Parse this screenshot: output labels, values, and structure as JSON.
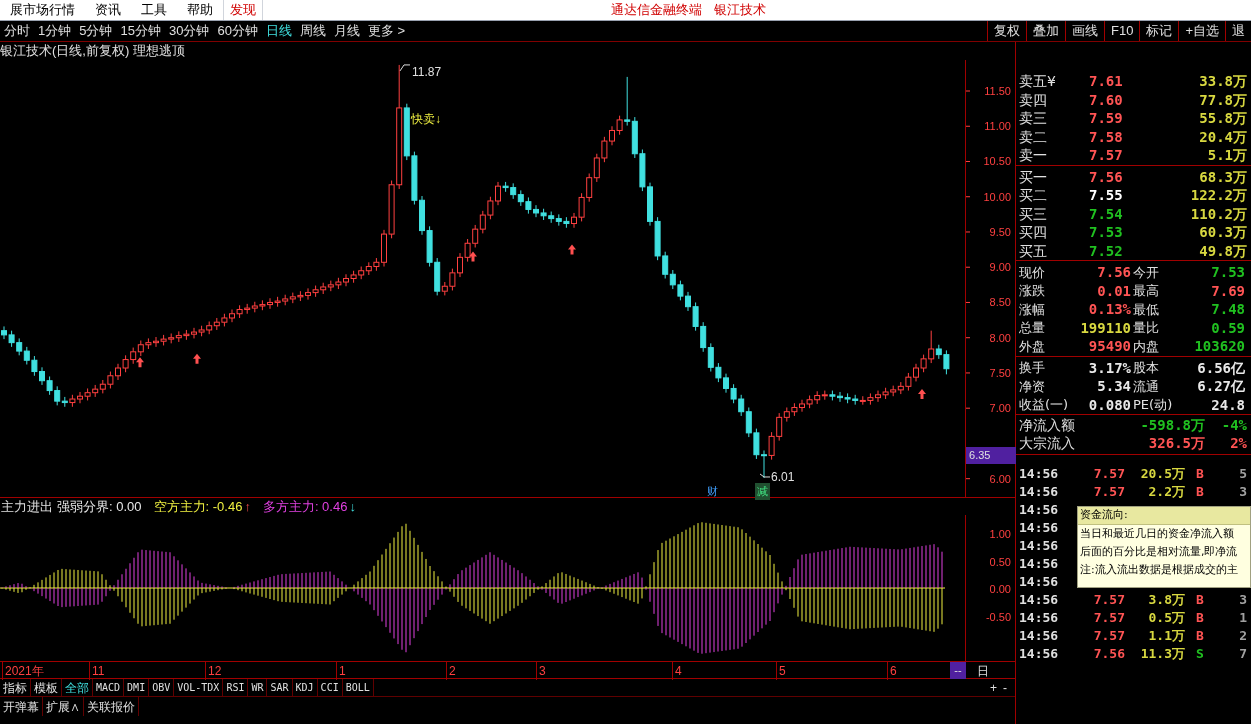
{
  "menu_bar": {
    "items": [
      "展市场行情",
      "资讯",
      "工具",
      "帮助"
    ],
    "discover": "发现",
    "app_title": "通达信金融终端",
    "stock_name": "银江技术"
  },
  "period_bar": {
    "periods": [
      {
        "label": "分时",
        "selected": false
      },
      {
        "label": "1分钟",
        "selected": false
      },
      {
        "label": "5分钟",
        "selected": false
      },
      {
        "label": "15分钟",
        "selected": false
      },
      {
        "label": "30分钟",
        "selected": false
      },
      {
        "label": "60分钟",
        "selected": false
      },
      {
        "label": "日线",
        "selected": true
      },
      {
        "label": "周线",
        "selected": false
      },
      {
        "label": "月线",
        "selected": false
      },
      {
        "label": "更多 >",
        "selected": false
      }
    ],
    "tools": [
      "复权",
      "叠加",
      "画线",
      "F10",
      "标记",
      "+自选",
      "退"
    ]
  },
  "chart_title": "银江技术(日线,前复权) 理想逃顶",
  "price_chart": {
    "chart_data": {
      "type": "candlestick",
      "ylim": [
        5.74,
        11.94
      ],
      "yticks": [
        {
          "value": 11.5,
          "label": "11.50"
        },
        {
          "value": 11,
          "label": "11.00"
        },
        {
          "value": 10.5,
          "label": "10.50"
        },
        {
          "value": 10,
          "label": "10.00"
        },
        {
          "value": 9.5,
          "label": "9.50"
        },
        {
          "value": 9,
          "label": "9.00"
        },
        {
          "value": 8.5,
          "label": "8.50"
        },
        {
          "value": 8,
          "label": "8.00"
        },
        {
          "value": 7.5,
          "label": "7.50"
        },
        {
          "value": 7,
          "label": "7.00"
        },
        {
          "value": 6,
          "label": "6.00"
        }
      ],
      "ohlc": [
        [
          8.1,
          8.16,
          7.98,
          8.04
        ],
        [
          8.04,
          8.1,
          7.87,
          7.93
        ],
        [
          7.93,
          7.99,
          7.75,
          7.81
        ],
        [
          7.81,
          7.87,
          7.62,
          7.68
        ],
        [
          7.68,
          7.74,
          7.46,
          7.52
        ],
        [
          7.52,
          7.58,
          7.33,
          7.39
        ],
        [
          7.39,
          7.45,
          7.19,
          7.25
        ],
        [
          7.25,
          7.31,
          7.04,
          7.1
        ],
        [
          7.1,
          7.16,
          7.02,
          7.08
        ],
        [
          7.08,
          7.19,
          7.02,
          7.13
        ],
        [
          7.13,
          7.23,
          7.07,
          7.17
        ],
        [
          7.17,
          7.28,
          7.11,
          7.22
        ],
        [
          7.22,
          7.33,
          7.16,
          7.27
        ],
        [
          7.27,
          7.4,
          7.21,
          7.34
        ],
        [
          7.34,
          7.52,
          7.28,
          7.46
        ],
        [
          7.46,
          7.63,
          7.4,
          7.57
        ],
        [
          7.57,
          7.75,
          7.51,
          7.69
        ],
        [
          7.69,
          7.86,
          7.63,
          7.8
        ],
        [
          7.8,
          7.96,
          7.74,
          7.9
        ],
        [
          7.9,
          7.99,
          7.84,
          7.93
        ],
        [
          7.93,
          8.01,
          7.87,
          7.95
        ],
        [
          7.95,
          8.04,
          7.89,
          7.98
        ],
        [
          7.98,
          8.06,
          7.92,
          8.0
        ],
        [
          8.0,
          8.09,
          7.94,
          8.03
        ],
        [
          8.03,
          8.11,
          7.97,
          8.05
        ],
        [
          8.05,
          8.14,
          7.99,
          8.08
        ],
        [
          8.08,
          8.17,
          8.02,
          8.11
        ],
        [
          8.11,
          8.23,
          8.05,
          8.17
        ],
        [
          8.17,
          8.28,
          8.11,
          8.22
        ],
        [
          8.22,
          8.34,
          8.16,
          8.28
        ],
        [
          8.28,
          8.4,
          8.22,
          8.34
        ],
        [
          8.34,
          8.46,
          8.28,
          8.4
        ],
        [
          8.4,
          8.48,
          8.34,
          8.42
        ],
        [
          8.42,
          8.51,
          8.36,
          8.45
        ],
        [
          8.45,
          8.53,
          8.39,
          8.47
        ],
        [
          8.47,
          8.56,
          8.41,
          8.5
        ],
        [
          8.5,
          8.58,
          8.44,
          8.52
        ],
        [
          8.52,
          8.61,
          8.46,
          8.55
        ],
        [
          8.55,
          8.64,
          8.49,
          8.58
        ],
        [
          8.58,
          8.66,
          8.52,
          8.6
        ],
        [
          8.6,
          8.7,
          8.54,
          8.64
        ],
        [
          8.64,
          8.74,
          8.58,
          8.68
        ],
        [
          8.68,
          8.78,
          8.62,
          8.72
        ],
        [
          8.72,
          8.81,
          8.66,
          8.75
        ],
        [
          8.75,
          8.85,
          8.69,
          8.79
        ],
        [
          8.79,
          8.9,
          8.73,
          8.84
        ],
        [
          8.84,
          8.95,
          8.78,
          8.89
        ],
        [
          8.89,
          9.01,
          8.83,
          8.95
        ],
        [
          8.95,
          9.07,
          8.89,
          9.01
        ],
        [
          9.01,
          9.13,
          8.95,
          9.07
        ],
        [
          9.07,
          9.53,
          9.01,
          9.47
        ],
        [
          9.47,
          10.23,
          9.41,
          10.17
        ],
        [
          10.17,
          11.87,
          10.11,
          11.26
        ],
        [
          11.26,
          11.32,
          10.52,
          10.58
        ],
        [
          10.58,
          10.64,
          9.89,
          9.95
        ],
        [
          9.95,
          10.01,
          9.46,
          9.52
        ],
        [
          9.52,
          9.58,
          9.01,
          9.07
        ],
        [
          9.07,
          9.13,
          8.6,
          8.66
        ],
        [
          8.66,
          8.79,
          8.6,
          8.73
        ],
        [
          8.73,
          8.98,
          8.67,
          8.92
        ],
        [
          8.92,
          9.2,
          8.86,
          9.14
        ],
        [
          9.14,
          9.4,
          9.08,
          9.34
        ],
        [
          9.34,
          9.6,
          9.28,
          9.54
        ],
        [
          9.54,
          9.8,
          9.48,
          9.74
        ],
        [
          9.74,
          10.0,
          9.68,
          9.94
        ],
        [
          9.94,
          10.21,
          9.88,
          10.15
        ],
        [
          10.15,
          10.21,
          10.07,
          10.13
        ],
        [
          10.13,
          10.19,
          9.97,
          10.03
        ],
        [
          10.03,
          10.09,
          9.87,
          9.93
        ],
        [
          9.93,
          9.99,
          9.76,
          9.82
        ],
        [
          9.82,
          9.88,
          9.71,
          9.77
        ],
        [
          9.77,
          9.83,
          9.67,
          9.73
        ],
        [
          9.73,
          9.79,
          9.63,
          9.69
        ],
        [
          9.69,
          9.75,
          9.59,
          9.65
        ],
        [
          9.65,
          9.71,
          9.56,
          9.62
        ],
        [
          9.62,
          9.77,
          9.56,
          9.71
        ],
        [
          9.71,
          10.05,
          9.65,
          9.99
        ],
        [
          9.99,
          10.33,
          9.93,
          10.27
        ],
        [
          10.27,
          10.61,
          10.21,
          10.55
        ],
        [
          10.55,
          10.85,
          10.49,
          10.79
        ],
        [
          10.79,
          11.0,
          10.73,
          10.94
        ],
        [
          10.94,
          11.15,
          10.88,
          11.09
        ],
        [
          11.09,
          11.7,
          11.01,
          11.07
        ],
        [
          11.07,
          11.13,
          10.55,
          10.61
        ],
        [
          10.61,
          10.67,
          10.08,
          10.14
        ],
        [
          10.14,
          10.2,
          9.59,
          9.65
        ],
        [
          9.65,
          9.71,
          9.1,
          9.16
        ],
        [
          9.16,
          9.22,
          8.84,
          8.9
        ],
        [
          8.9,
          8.96,
          8.69,
          8.75
        ],
        [
          8.75,
          8.81,
          8.53,
          8.59
        ],
        [
          8.59,
          8.65,
          8.38,
          8.44
        ],
        [
          8.44,
          8.5,
          8.1,
          8.16
        ],
        [
          8.16,
          8.22,
          7.8,
          7.86
        ],
        [
          7.86,
          7.92,
          7.52,
          7.58
        ],
        [
          7.58,
          7.64,
          7.37,
          7.43
        ],
        [
          7.43,
          7.49,
          7.22,
          7.28
        ],
        [
          7.28,
          7.34,
          7.07,
          7.13
        ],
        [
          7.13,
          7.19,
          6.89,
          6.95
        ],
        [
          6.95,
          7.01,
          6.59,
          6.65
        ],
        [
          6.65,
          6.71,
          6.28,
          6.34
        ],
        [
          6.34,
          6.4,
          6.01,
          6.33
        ],
        [
          6.33,
          6.66,
          6.27,
          6.6
        ],
        [
          6.6,
          6.93,
          6.54,
          6.87
        ],
        [
          6.87,
          7.01,
          6.81,
          6.95
        ],
        [
          6.95,
          7.07,
          6.89,
          7.01
        ],
        [
          7.01,
          7.12,
          6.95,
          7.06
        ],
        [
          7.06,
          7.18,
          7.0,
          7.12
        ],
        [
          7.12,
          7.24,
          7.06,
          7.18
        ],
        [
          7.18,
          7.25,
          7.12,
          7.19
        ],
        [
          7.19,
          7.25,
          7.11,
          7.17
        ],
        [
          7.17,
          7.23,
          7.09,
          7.15
        ],
        [
          7.15,
          7.21,
          7.07,
          7.13
        ],
        [
          7.13,
          7.19,
          7.05,
          7.11
        ],
        [
          7.11,
          7.17,
          7.05,
          7.11
        ],
        [
          7.11,
          7.21,
          7.05,
          7.15
        ],
        [
          7.15,
          7.25,
          7.09,
          7.19
        ],
        [
          7.19,
          7.29,
          7.13,
          7.23
        ],
        [
          7.23,
          7.32,
          7.17,
          7.26
        ],
        [
          7.26,
          7.37,
          7.2,
          7.31
        ],
        [
          7.31,
          7.5,
          7.25,
          7.44
        ],
        [
          7.44,
          7.63,
          7.38,
          7.57
        ],
        [
          7.57,
          7.76,
          7.51,
          7.7
        ],
        [
          7.7,
          8.1,
          7.64,
          7.84
        ],
        [
          7.84,
          7.9,
          7.7,
          7.76
        ],
        [
          7.76,
          7.82,
          7.48,
          7.56
        ]
      ]
    }
  },
  "price_tag": "6.35",
  "markers": {
    "high": "11.87",
    "low": "6.01",
    "signal": "快卖↓",
    "badges": [
      "财",
      "减"
    ]
  },
  "indicator": {
    "name": "主力进出",
    "items": [
      {
        "label": "强弱分界: 0.00",
        "color": "#e8e8e8"
      },
      {
        "label": "空方主力: -0.46",
        "color": "#f0f040",
        "arrow": "↑"
      },
      {
        "label": "多方主力: 0.46",
        "color": "#e040e0",
        "arrow": "↓"
      }
    ]
  },
  "osc_axis": [
    "1.00",
    "0.50",
    "0.00",
    "-0.50"
  ],
  "date_axis": [
    "2021年",
    "11",
    "12",
    "1",
    "2",
    "3",
    "4",
    "5",
    "6"
  ],
  "date_end": "--",
  "period_label": "日",
  "indicator_tabs": [
    {
      "label": "指标",
      "selected": false
    },
    {
      "label": "模板",
      "selected": false
    },
    {
      "label": "全部",
      "selected": true
    },
    {
      "label": "MACD",
      "selected": false
    },
    {
      "label": "DMI",
      "selected": false
    },
    {
      "label": "OBV",
      "selected": false
    },
    {
      "label": "VOL-TDX",
      "selected": false
    },
    {
      "label": "RSI",
      "selected": false
    },
    {
      "label": "WR",
      "selected": false
    },
    {
      "label": "SAR",
      "selected": false
    },
    {
      "label": "KDJ",
      "selected": false
    },
    {
      "label": "CCI",
      "selected": false
    },
    {
      "label": "BOLL",
      "selected": false
    }
  ],
  "zoom_buttons": [
    "+",
    "-"
  ],
  "bottom_bar": [
    "开弹幕",
    "扩展∧",
    "关联报价"
  ],
  "quote": {
    "asks": [
      {
        "label": "卖五¥",
        "price": "7.61",
        "volume": "33.8万",
        "color": "#ff5454"
      },
      {
        "label": "卖四",
        "price": "7.60",
        "volume": "77.8万",
        "color": "#ff5454"
      },
      {
        "label": "卖三",
        "price": "7.59",
        "volume": "55.8万",
        "color": "#ff5454"
      },
      {
        "label": "卖二",
        "price": "7.58",
        "volume": "20.4万",
        "color": "#ff5454"
      },
      {
        "label": "卖一",
        "price": "7.57",
        "volume": "5.1万",
        "color": "#ff5454"
      }
    ],
    "bids": [
      {
        "label": "买一",
        "price": "7.56",
        "volume": "68.3万",
        "color": "#ff5454"
      },
      {
        "label": "买二",
        "price": "7.55",
        "volume": "122.2万",
        "color": "#ffffff"
      },
      {
        "label": "买三",
        "price": "7.54",
        "volume": "110.2万",
        "color": "#20c020"
      },
      {
        "label": "买四",
        "price": "7.53",
        "volume": "60.3万",
        "color": "#20c020"
      },
      {
        "label": "买五",
        "price": "7.52",
        "volume": "49.8万",
        "color": "#20c020"
      }
    ],
    "stats": [
      [
        {
          "label": "现价",
          "value": "7.56",
          "color": "#ff5454"
        },
        {
          "label": "今开",
          "value": "7.53",
          "color": "#20c020"
        }
      ],
      [
        {
          "label": "涨跌",
          "value": "0.01",
          "color": "#ff5454"
        },
        {
          "label": "最高",
          "value": "7.69",
          "color": "#ff5454"
        }
      ],
      [
        {
          "label": "涨幅",
          "value": "0.13%",
          "color": "#ff5454"
        },
        {
          "label": "最低",
          "value": "7.48",
          "color": "#20c020"
        }
      ],
      [
        {
          "label": "总量",
          "value": "199110",
          "color": "#d8d840"
        },
        {
          "label": "量比",
          "value": "0.59",
          "color": "#20c020"
        }
      ],
      [
        {
          "label": "外盘",
          "value": "95490",
          "color": "#ff5454"
        },
        {
          "label": "内盘",
          "value": "103620",
          "color": "#20c020"
        }
      ]
    ],
    "finance": [
      [
        {
          "label": "换手",
          "value": "3.17%",
          "color": "#e8e8e8"
        },
        {
          "label": "股本",
          "value": "6.56亿",
          "color": "#e8e8e8"
        }
      ],
      [
        {
          "label": "净资",
          "value": "5.34",
          "color": "#e8e8e8"
        },
        {
          "label": "流通",
          "value": "6.27亿",
          "color": "#e8e8e8"
        }
      ],
      [
        {
          "label": "收益(一)",
          "value": "0.080",
          "color": "#e8e8e8"
        },
        {
          "label": "PE(动)",
          "value": "24.8",
          "color": "#e8e8e8"
        }
      ]
    ],
    "flows": [
      {
        "label": "净流入额",
        "amount": "-598.8万",
        "pct": "-4%",
        "color": "#20c020"
      },
      {
        "label": "大宗流入",
        "amount": "326.5万",
        "pct": "2%",
        "color": "#ff5454"
      }
    ],
    "trades": [
      {
        "time": "14:56",
        "price": "7.57",
        "volume": "20.5万",
        "side": "B",
        "count": "5"
      },
      {
        "time": "14:56",
        "price": "7.57",
        "volume": "2.2万",
        "side": "B",
        "count": "3"
      },
      {
        "time": "14:56"
      },
      {
        "time": "14:56"
      },
      {
        "time": "14:56"
      },
      {
        "time": "14:56"
      },
      {
        "time": "14:56"
      },
      {
        "time": "14:56",
        "price": "7.57",
        "volume": "3.8万",
        "side": "B",
        "count": "3"
      },
      {
        "time": "14:56",
        "price": "7.57",
        "volume": "0.5万",
        "side": "B",
        "count": "1"
      },
      {
        "time": "14:56",
        "price": "7.57",
        "volume": "1.1万",
        "side": "B",
        "count": "2"
      },
      {
        "time": "14:56",
        "price": "7.56",
        "volume": "11.3万",
        "side": "S",
        "count": "7"
      }
    ]
  },
  "tooltip": {
    "title": "资金流向:",
    "lines": [
      "当日和最近几日的资金净流入额",
      "后面的百分比是相对流量,即净流",
      "注:流入流出数据是根据成交的主"
    ]
  }
}
